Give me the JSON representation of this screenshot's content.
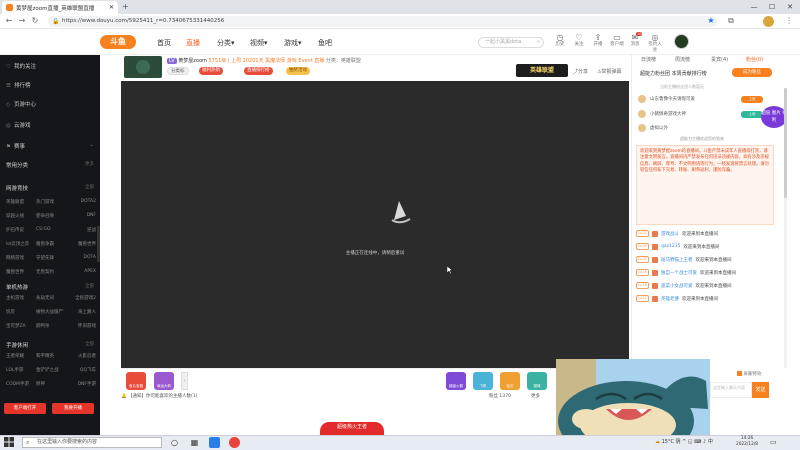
{
  "browser": {
    "tab_title": "黄梦屋zoom直播_英雄联盟直播",
    "url": "https://www.douyu.com/5925411_r=0.7340675331440256",
    "controls": {
      "minimize": "—",
      "maximize": "☐",
      "close": "✕"
    }
  },
  "header": {
    "logo": "斗鱼",
    "nav": [
      "首页",
      "直播",
      "分类",
      "视频",
      "游戏",
      "鱼吧"
    ],
    "nav_active": "直播",
    "search_placeholder": "一起小黑黑dota",
    "icons": [
      {
        "name": "history",
        "label": "历史"
      },
      {
        "name": "follow",
        "label": "关注"
      },
      {
        "name": "upload",
        "label": "开播"
      },
      {
        "name": "client",
        "label": "客户端"
      },
      {
        "name": "message",
        "label": "消息"
      },
      {
        "name": "guide",
        "label": "签约入驻"
      }
    ],
    "badge_count": "10"
  },
  "sidebar": {
    "items": [
      {
        "icon": "♡",
        "label": "我的关注"
      },
      {
        "icon": "☰",
        "label": "排行榜"
      },
      {
        "icon": "◇",
        "label": "页游中心"
      },
      {
        "icon": "◎",
        "label": "云游戏"
      },
      {
        "icon": "⚑",
        "label": "赛事"
      }
    ],
    "common_label": "常用分类",
    "common_more": "更多",
    "sections": [
      {
        "title": "网游竞技",
        "more": "全部",
        "games": [
          "英雄联盟",
          "热门游戏",
          "DOTA2",
          "穿越火线",
          "使命召唤",
          "DNF",
          "炉石传说",
          "CS:GO",
          "逆战",
          "lol云顶之弈",
          "魔兽争霸",
          "魔兽世界",
          "网络游戏",
          "守望先锋",
          "DOTA",
          "魔兽世界",
          "无畏契约",
          "APEX"
        ]
      },
      {
        "title": "单机热游",
        "more": "全部",
        "games": [
          "主机游戏",
          "永劫无间",
          "全民游戏2",
          "饥荒",
          "植物大战僵尸",
          "海上路人",
          "宝可梦ZA",
          "鹅鸭杀",
          "怀旧游戏"
        ]
      },
      {
        "title": "手游休闲",
        "more": "全部",
        "games": [
          "王者荣耀",
          "和平精英",
          "火影忍者",
          "LOL手游",
          "金铲铲之战",
          "QQ飞车",
          "CODM手游",
          "原神",
          "DNF手游"
        ]
      }
    ],
    "btn_client": "客户端打开",
    "btn_live": "我要开播"
  },
  "room": {
    "streamer_name": "黄梦屋zoom",
    "level_badge": "LV",
    "info_text": "5751级 | 上周 20201天 黑魔法师 游戏 Event 直播",
    "category": "分类：英雄联盟",
    "tags": [
      "分类标",
      "福利热销",
      "直播排行榜",
      "抽奖活动"
    ],
    "banner": "英雄联盟",
    "share_label": "分享",
    "report_label": "举报弹幕",
    "video_status": "主播正在连线中，请稍后重试",
    "notice": "【通知】你可能喜欢的主播人数(1)",
    "fan_count": "粉丝 1370",
    "more_label": "更多",
    "gifts": [
      {
        "label": "鱼丸宝箱",
        "color": "#e94c3a"
      },
      {
        "label": "幸运大转",
        "color": "#9b59d0"
      }
    ],
    "gifts_right": [
      {
        "label": "超级火箭",
        "color": "#7e4bd8"
      },
      {
        "label": "飞机",
        "color": "#4bb2d8"
      },
      {
        "label": "钻石",
        "color": "#f0a030"
      },
      {
        "label": "猫咪",
        "color": "#3bb3a3"
      }
    ],
    "bottom_banner": "超级热火王者"
  },
  "right_panel": {
    "tabs": [
      "日流榜",
      "周流榜",
      "贵宾(4)",
      "粉丝(0)"
    ],
    "tab_active": "粉丝(0)",
    "rank_title": "超能力粉丝团 本周贡献排行榜",
    "fans_button": "成为粉丝",
    "rank_note": "当前主播粉丝团人数暂无",
    "rank_rows": [
      {
        "name": "山东鲁豫今天请假可爱",
        "tag": "上贡",
        "tag_color": "#f7801f"
      },
      {
        "name": "小猪佩奇游戏大神",
        "tag": "上贡",
        "tag_color": "#2fb89b"
      },
      {
        "name": "虚拟以外",
        "tag": "",
        "tag_color": ""
      }
    ],
    "super_value": "超值\n图片\n福利",
    "chat_title": "超能力主播欢迎您的到来",
    "welcome_text": "欢迎来到黄梦屋zoom的直播间。斗鱼严禁未成年人直播或打赏，请注意文明发言。直播间内严禁发布任何违法违规内容，如有涉及违规信息、刷屏、辱骂、不文明用语等行为，一经发现将禁言处理。请勿轻信任何私下交易、转账、刷单返利，谨防诈骗。",
    "messages": [
      {
        "level": "LV.22",
        "nick": "游戏战斗",
        "text": "欢迎来到本直播间"
      },
      {
        "level": "LV.50",
        "nick": "qaz1235",
        "text": "欢迎来到本直播间"
      },
      {
        "level": "LV.22",
        "nick": "斑马野猫上王者",
        "text": "欢迎来到本直播间"
      },
      {
        "level": "LV.19",
        "nick": "独自一个战士可爱",
        "text": "欢迎来到本直播间"
      },
      {
        "level": "LV.18",
        "nick": "菠菜小女战可爱",
        "text": "欢迎来到本直播间"
      },
      {
        "level": "LV.12",
        "nick": "英雄老婆",
        "text": "欢迎来到本直播间"
      }
    ],
    "gift_effect_label": "屏蔽特效",
    "input_placeholder": "这里输入聊天内容",
    "send_label": "发送"
  },
  "taskbar": {
    "search_placeholder": "在这里输入你要搜索的内容",
    "weather": "15°C 阴",
    "sys_icons": "^ ◱ ⌨ ♪ 中",
    "time": "14:26",
    "date": "2022/12/8"
  }
}
